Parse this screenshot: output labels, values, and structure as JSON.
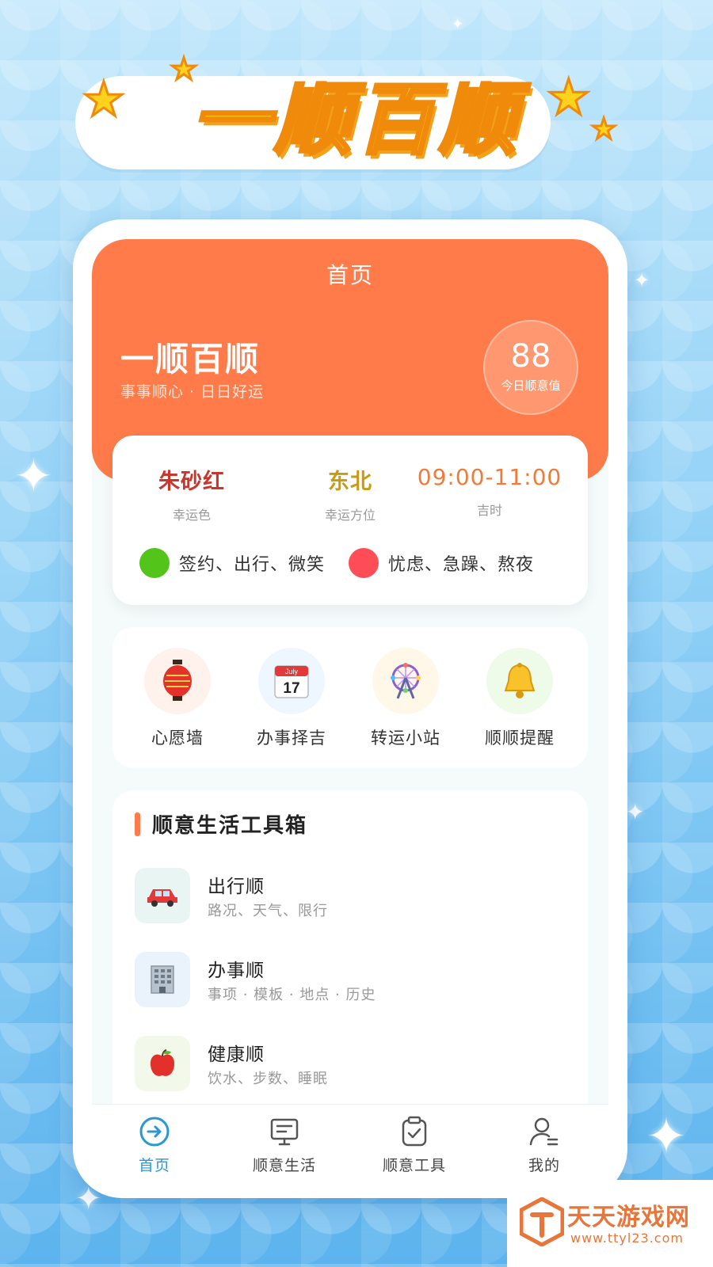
{
  "banner": {
    "title": "一顺百顺"
  },
  "app": {
    "nav_title": "首页",
    "brand": "一顺百顺",
    "slogan": "事事顺心 · 日日好运",
    "score": {
      "value": "88",
      "label": "今日顺意值"
    }
  },
  "lucky": {
    "items": [
      {
        "value": "朱砂红",
        "label": "幸运色",
        "color": "#c8372d"
      },
      {
        "value": "东北",
        "label": "幸运方位",
        "color": "#c99a12"
      },
      {
        "value": "09:00-11:00",
        "label": "吉时",
        "color": "#ef7b3a"
      }
    ],
    "good": {
      "text": "签约、出行、微笑",
      "color": "#52c41a"
    },
    "bad": {
      "text": "忧虑、急躁、熬夜",
      "color": "#ff4d57"
    }
  },
  "quick": [
    {
      "label": "心愿墙",
      "icon": "lantern-icon"
    },
    {
      "label": "办事择吉",
      "icon": "calendar-icon",
      "cal_month": "July",
      "cal_day": "17"
    },
    {
      "label": "转运小站",
      "icon": "ferris-wheel-icon"
    },
    {
      "label": "顺顺提醒",
      "icon": "bell-icon"
    }
  ],
  "tools": {
    "title": "顺意生活工具箱",
    "items": [
      {
        "name": "出行顺",
        "desc": "路况、天气、限行",
        "icon": "car-icon"
      },
      {
        "name": "办事顺",
        "desc": "事项 · 模板 · 地点 · 历史",
        "icon": "office-building-icon"
      },
      {
        "name": "健康顺",
        "desc": "饮水、步数、睡眠",
        "icon": "apple-icon"
      }
    ]
  },
  "tabbar": [
    {
      "label": "首页",
      "icon": "home-arrow-icon",
      "active": true
    },
    {
      "label": "顺意生活",
      "icon": "monitor-icon",
      "active": false
    },
    {
      "label": "顺意工具",
      "icon": "clipboard-check-icon",
      "active": false
    },
    {
      "label": "我的",
      "icon": "user-icon",
      "active": false
    }
  ],
  "watermark": {
    "name": "天天游戏网",
    "url": "www.ttyl23.com"
  },
  "colors": {
    "primary": "#ff7b4a",
    "tab_active": "#2a97d3"
  }
}
